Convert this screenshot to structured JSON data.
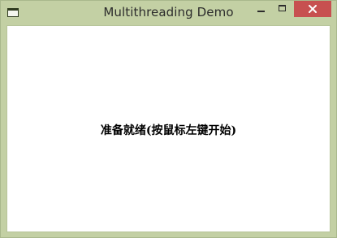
{
  "window": {
    "title": "Multithreading Demo",
    "frame_color": "#c3d0a4",
    "close_color": "#c75050"
  },
  "titlebar": {
    "system_menu_icon": "window-icon",
    "minimize_icon": "minimize-icon",
    "maximize_icon": "maximize-icon",
    "close_icon": "close-icon"
  },
  "client": {
    "status_text": "准备就绪(按鼠标左键开始)"
  }
}
